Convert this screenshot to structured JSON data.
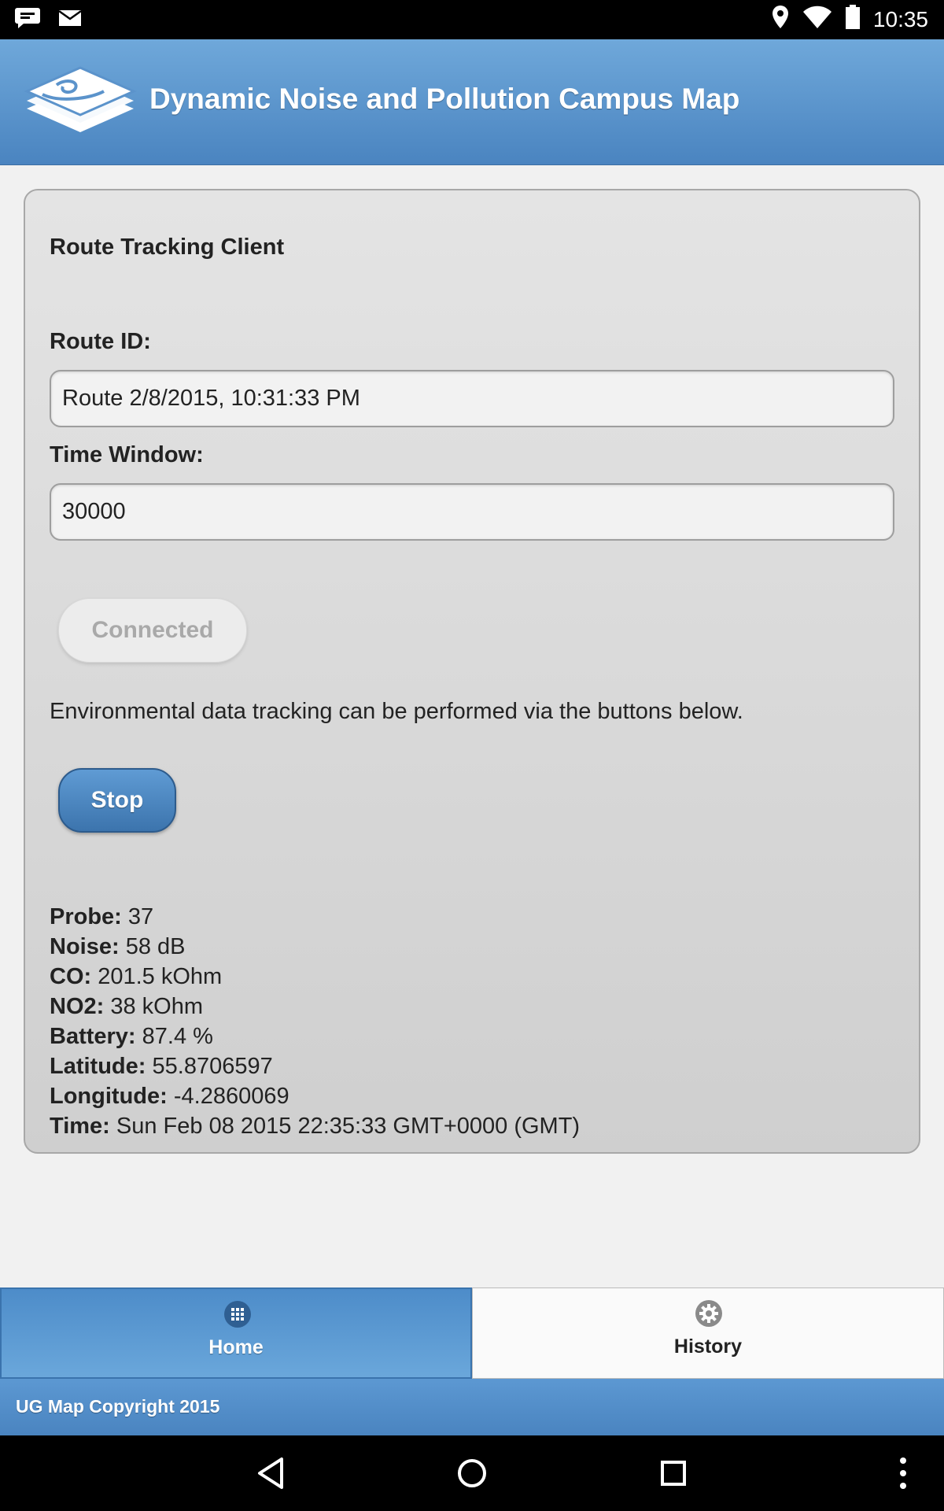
{
  "status_bar": {
    "time": "10:35",
    "left_icons": [
      "chat-icon",
      "mail-icon"
    ],
    "right_icons": [
      "location-icon",
      "wifi-icon",
      "battery-icon"
    ]
  },
  "header": {
    "title": "Dynamic Noise and Pollution Campus Map",
    "brand_color": "#4a84c0"
  },
  "panel": {
    "title": "Route Tracking Client",
    "route_id_label": "Route ID:",
    "route_id_value": "Route 2/8/2015, 10:31:33 PM",
    "time_window_label": "Time Window:",
    "time_window_value": "30000",
    "connected_button": "Connected",
    "info_text": "Environmental data tracking can be performed via the buttons below.",
    "stop_button": "Stop"
  },
  "readings": [
    {
      "label": "Probe:",
      "value": "37"
    },
    {
      "label": "Noise:",
      "value": "58 dB"
    },
    {
      "label": "CO:",
      "value": "201.5 kOhm"
    },
    {
      "label": "NO2:",
      "value": "38 kOhm"
    },
    {
      "label": "Battery:",
      "value": "87.4 %"
    },
    {
      "label": "Latitude:",
      "value": "55.8706597"
    },
    {
      "label": "Longitude:",
      "value": "-4.2860069"
    },
    {
      "label": "Time:",
      "value": "Sun Feb 08 2015 22:35:33 GMT+0000 (GMT)"
    }
  ],
  "tabs": [
    {
      "label": "Home",
      "icon": "grid-icon",
      "active": true
    },
    {
      "label": "History",
      "icon": "gear-icon",
      "active": false
    }
  ],
  "footer": {
    "text": "UG Map Copyright 2015"
  },
  "nav_bar": {
    "buttons": [
      "back-icon",
      "home-circle-icon",
      "recents-icon",
      "overflow-menu-icon"
    ]
  }
}
